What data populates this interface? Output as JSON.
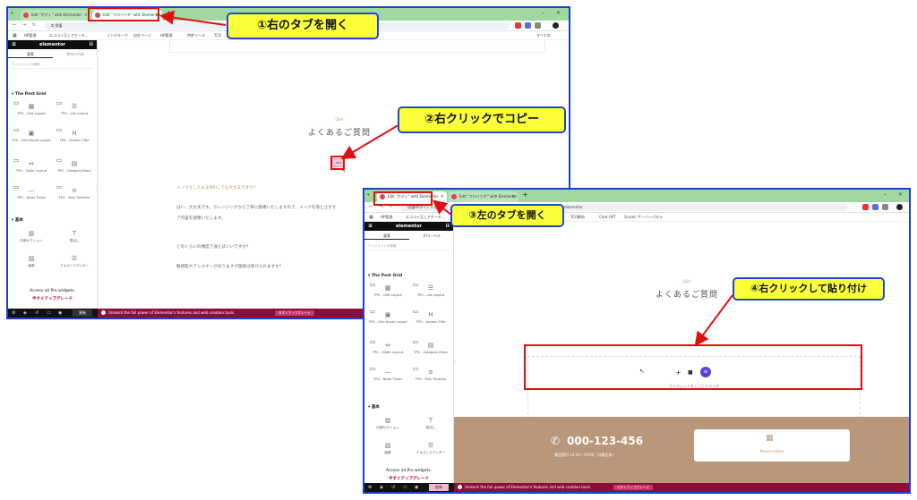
{
  "windows": {
    "first": {
      "tabs": [
        {
          "label": "Edit \"ボディ\" with Elementor"
        },
        {
          "label": "Edit \"フロイツギ\" with Elementor"
        }
      ],
      "address": "保護",
      "bookmarks": [
        "HP管理",
        "エココイ玉しアチーキ...",
        "インデキーク",
        "自社ページ",
        "HP管理",
        "特許ツール",
        "TCO"
      ],
      "bookmarks_right": "すべての",
      "faq_items": [
        "メイクをしたままMRIしても大丈夫ですか？",
        "はい、大丈夫です。クレンジングから丁寧に施術いたしますので、メイクを落とさずそ",
        "ア内容を調整いたします。",
        "どのくらいの頻度で通えばいいですか？",
        "敏感肌やアレルギーがありますが施術は受けられますか？"
      ],
      "mini_button": "Edit"
    },
    "second": {
      "tabs": [
        {
          "label": "Edit \"ボディ\" with Elementor"
        },
        {
          "label": "Edit \"フロイツギ\" with Elementor"
        }
      ],
      "address": "保護HPタイトル名所",
      "address_suffix": "=elementor",
      "bookmarks": [
        "HP管理",
        "エココイ玉しアチーキ...",
        "TCO解析",
        "Chat GPT",
        "Screen サーバーパネル"
      ],
      "phone": "000-123-456",
      "phone_hours": "電話受付 10:00〜19:00（月曜定休）",
      "reservation": "Reservation",
      "drop_hint": "ウィジェットをここにドラッグ"
    }
  },
  "panel": {
    "brand": "elementor",
    "tab_elements": "要素",
    "tab_global": "グローバル",
    "search_placeholder": "ウィジェットの検索",
    "section_post_grid": "▾ The Post Grid",
    "widgets": [
      {
        "label": "TPG - Grid Layout",
        "icon": "grid-icon"
      },
      {
        "label": "TPG - List Layout",
        "icon": "list-icon"
      },
      {
        "label": "TPG - Grid Hover Layout",
        "icon": "grid-hover-icon"
      },
      {
        "label": "TPG - Section Title",
        "icon": "heading-icon"
      },
      {
        "label": "TPG - Slider Layout",
        "icon": "slider-icon"
      },
      {
        "label": "TPG - Category Block",
        "icon": "category-icon"
      },
      {
        "label": "TPG - News Ticker",
        "icon": "ticker-icon"
      },
      {
        "label": "TPG - Post Timeline",
        "icon": "timeline-icon"
      }
    ],
    "section_basic": "▾ 基本",
    "basic_widgets": [
      {
        "label": "内部セクション"
      },
      {
        "label": "見出し"
      },
      {
        "label": "画像"
      },
      {
        "label": "テキストエディター"
      }
    ],
    "pro_title": "Access all Pro widgets.",
    "pro_cta": "今すぐアップグレード"
  },
  "footer": {
    "message": "Unleash the full power of Elementor's features and web creation tools.",
    "upgrade": "今すぐアップグレード",
    "preview": "更新"
  },
  "content": {
    "qa_small": "Q&A",
    "qa_title": "よくあるご質問"
  },
  "callouts": {
    "c1": "①右のタブを開く",
    "c2": "②右クリックでコピー",
    "c3": "③左のタブを開く",
    "c4": "④右クリックして貼り付け"
  },
  "colors": {
    "callout_fill": "#fbff3a",
    "callout_border": "#1f47d6",
    "highlight_red": "#e01010",
    "brown_band": "#b8977a",
    "footer_magenta": "#8a0d3c"
  }
}
